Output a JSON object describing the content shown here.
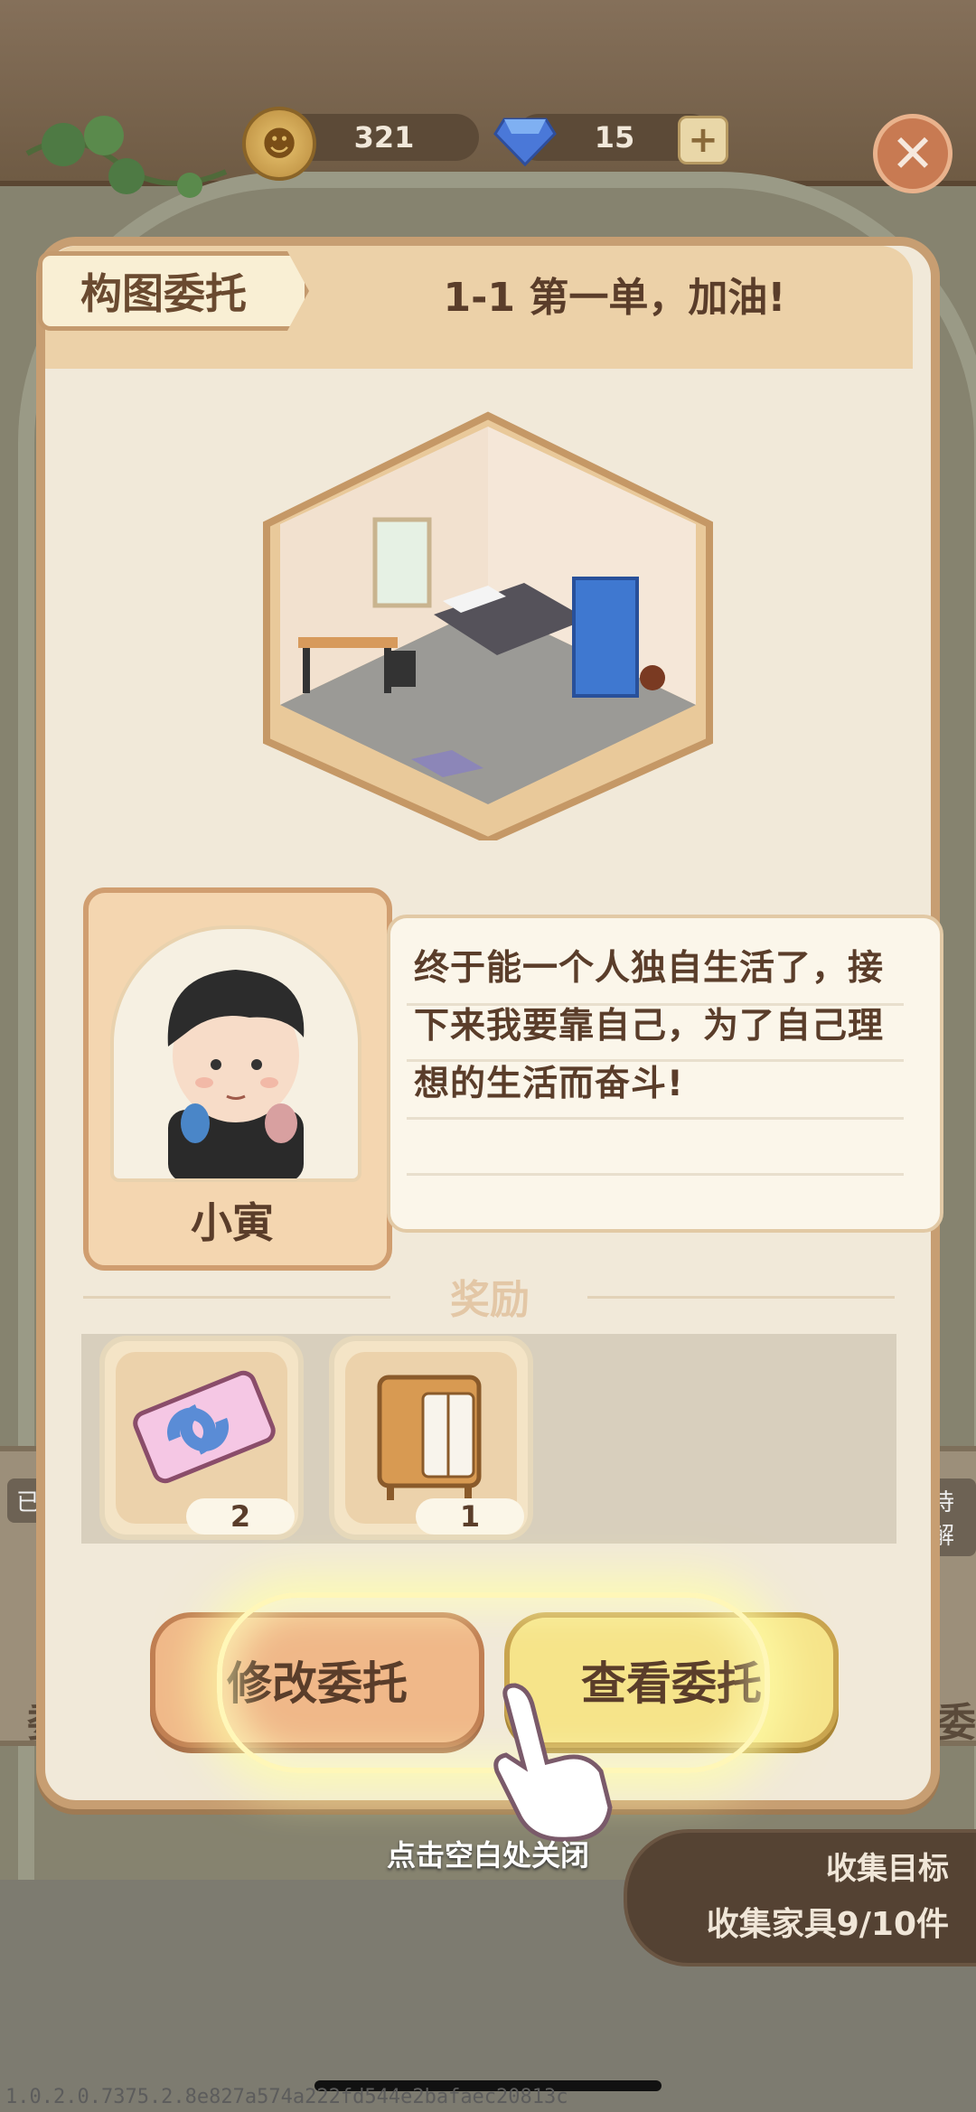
{
  "currency": {
    "coins": "321",
    "gems": "15"
  },
  "dialog": {
    "tag": "构图委托",
    "title": "1-1 第一单，加油!"
  },
  "character": {
    "name": "小寅",
    "speech_line1": "终于能一个人独自生活了，接",
    "speech_line2": "下来我要靠自己，为了自己理",
    "speech_line3": "想的生活而奋斗!"
  },
  "rewards": {
    "title": "奖励",
    "items": [
      {
        "icon": "ticket-icon",
        "count": "2"
      },
      {
        "icon": "wardrobe-icon",
        "count": "1"
      }
    ]
  },
  "buttons": {
    "modify": "修改委托",
    "view": "查看委托"
  },
  "hint": "点击空白处关闭",
  "collect": {
    "label": "收集目标",
    "progress": "收集家具9/10件"
  },
  "side": {
    "left_tag": "已完",
    "right_tag": "待解",
    "left_char": "委",
    "right_char": "委"
  },
  "version": "1.0.2.0.7375.2.8e827a574a222fd544e2bafaec20813c"
}
